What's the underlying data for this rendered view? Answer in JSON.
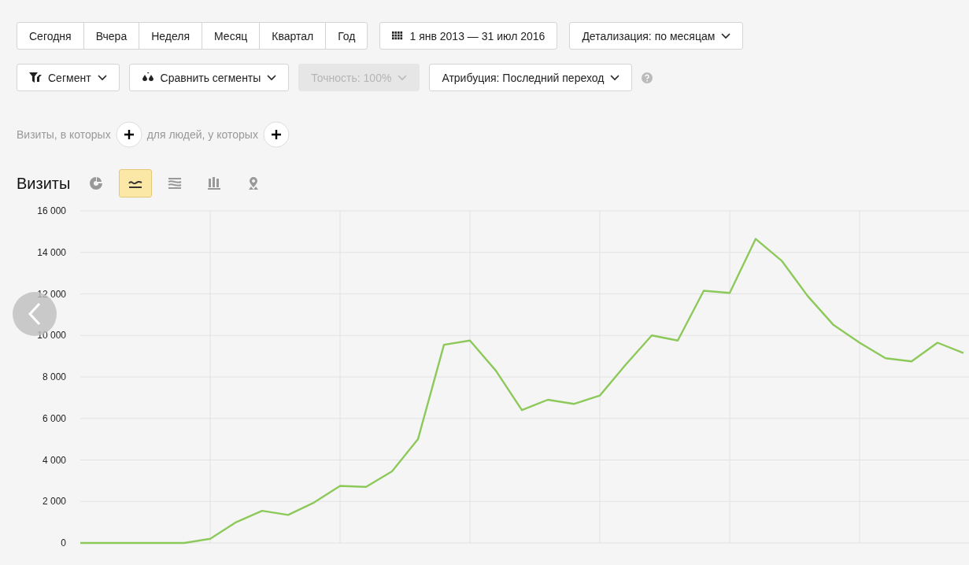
{
  "periods": [
    {
      "label": "Сегодня",
      "selected": false
    },
    {
      "label": "Вчера",
      "selected": false
    },
    {
      "label": "Неделя",
      "selected": false
    },
    {
      "label": "Месяц",
      "selected": false
    },
    {
      "label": "Квартал",
      "selected": false
    },
    {
      "label": "Год",
      "selected": false
    }
  ],
  "date_range": "1 янв 2013 — 31 июл 2016",
  "detail": "Детализация: по месяцам",
  "filters": [
    {
      "kind": "segment",
      "label": "Сегмент",
      "disabled": false
    },
    {
      "kind": "compare",
      "label": "Сравнить сегменты",
      "disabled": false
    },
    {
      "kind": "plain",
      "label": "Точность: 100%",
      "disabled": true
    },
    {
      "kind": "plain",
      "label": "Атрибуция: Последний переход",
      "disabled": false
    }
  ],
  "conditions": [
    "Визиты, в которых",
    "для людей, у которых"
  ],
  "metric_title": "Визиты",
  "chart_types": [
    {
      "kind": "pie",
      "selected": false
    },
    {
      "kind": "line",
      "selected": true
    },
    {
      "kind": "area",
      "selected": false
    },
    {
      "kind": "bar",
      "selected": false
    },
    {
      "kind": "map",
      "selected": false
    }
  ],
  "chart": {
    "chart_data": {
      "type": "line",
      "grid": true,
      "ylim": [
        0,
        16000
      ],
      "yticks": [
        {
          "value": 0,
          "label": "0"
        },
        {
          "value": 2000,
          "label": "2 000"
        },
        {
          "value": 4000,
          "label": "4 000"
        },
        {
          "value": 6000,
          "label": "6 000"
        },
        {
          "value": 8000,
          "label": "8 000"
        },
        {
          "value": 10000,
          "label": "10 000"
        },
        {
          "value": 12000,
          "label": "12 000"
        },
        {
          "value": 14000,
          "label": "14 000"
        },
        {
          "value": 16000,
          "label": "16 000"
        }
      ],
      "series": [
        {
          "color": "#8dc95a",
          "values": [
            0,
            0,
            0,
            0,
            0,
            200,
            1000,
            1550,
            1350,
            1950,
            2750,
            2700,
            3450,
            5000,
            9550,
            9750,
            8300,
            6400,
            6900,
            6700,
            7100,
            8600,
            10000,
            9750,
            12150,
            12050,
            14650,
            13600,
            11900,
            10500,
            9650,
            8900,
            8750,
            9650,
            9150
          ]
        }
      ]
    }
  }
}
